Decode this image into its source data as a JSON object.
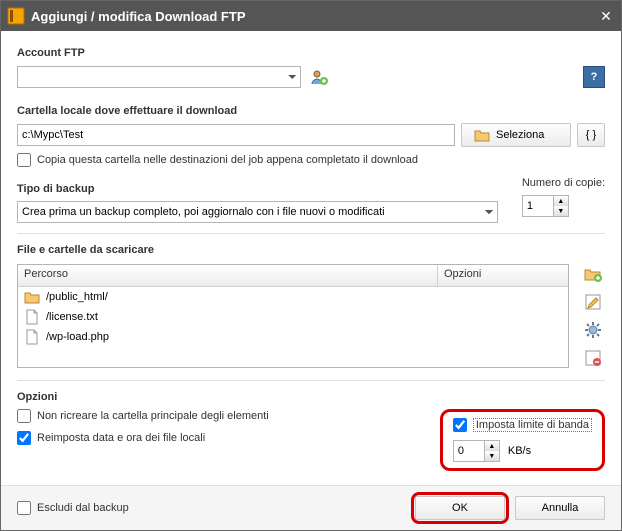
{
  "titlebar": {
    "title": "Aggiungi / modifica Download FTP"
  },
  "account": {
    "label": "Account FTP",
    "selected": " "
  },
  "localFolder": {
    "label": "Cartella locale dove effettuare il download",
    "value": "c:\\Mypc\\Test",
    "selectBtn": "Seleziona",
    "copyCheckbox": "Copia questa cartella nelle destinazioni del job appena completato il download"
  },
  "backupType": {
    "label": "Tipo di backup",
    "selected": "Crea prima un backup completo, poi aggiornalo con i file nuovi o modificati",
    "copiesLabel": "Numero di copie:",
    "copiesValue": "1"
  },
  "fileList": {
    "label": "File e cartelle da scaricare",
    "col1": "Percorso",
    "col2": "Opzioni",
    "rows": [
      {
        "type": "folder",
        "name": "/public_html/"
      },
      {
        "type": "file",
        "name": "/license.txt"
      },
      {
        "type": "file",
        "name": "/wp-load.php"
      }
    ]
  },
  "options": {
    "label": "Opzioni",
    "noRecreate": {
      "label": "Non ricreare la cartella principale degli elementi",
      "checked": false
    },
    "resetDate": {
      "label": "Reimposta data e ora dei file locali",
      "checked": true
    },
    "bandLimit": {
      "label": "Imposta limite di banda",
      "checked": true
    },
    "bandValue": "0",
    "bandUnit": "KB/s"
  },
  "footer": {
    "exclude": "Escludi dal backup",
    "ok": "OK",
    "cancel": "Annulla"
  }
}
